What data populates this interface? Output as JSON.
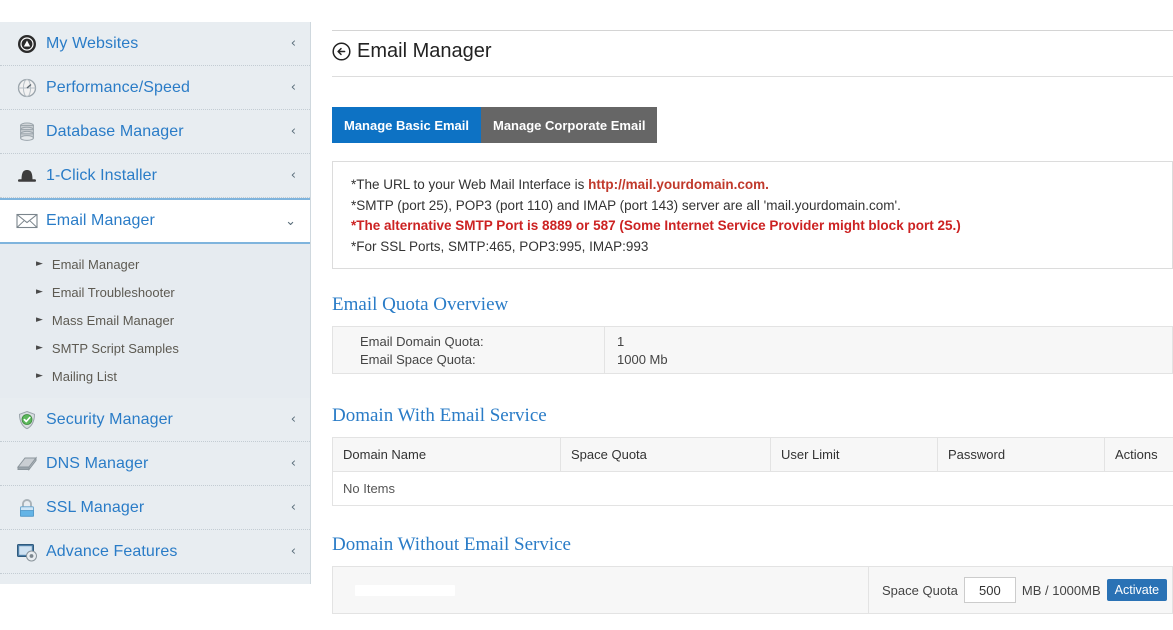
{
  "sidebar": {
    "items": [
      {
        "label": "My Websites",
        "icon": "globe-triangle-icon",
        "chevron": "‹",
        "active": false
      },
      {
        "label": "Performance/Speed",
        "icon": "speedometer-globe-icon",
        "chevron": "‹",
        "active": false
      },
      {
        "label": "Database Manager",
        "icon": "database-icon",
        "chevron": "‹",
        "active": false
      },
      {
        "label": "1-Click Installer",
        "icon": "hat-icon",
        "chevron": "‹",
        "active": false
      },
      {
        "label": "Email Manager",
        "icon": "envelope-icon",
        "chevron": "⌄",
        "active": true
      },
      {
        "label": "Security Manager",
        "icon": "shield-check-icon",
        "chevron": "‹",
        "active": false
      },
      {
        "label": "DNS Manager",
        "icon": "dns-icon",
        "chevron": "‹",
        "active": false
      },
      {
        "label": "SSL Manager",
        "icon": "lock-icon",
        "chevron": "‹",
        "active": false
      },
      {
        "label": "Advance Features",
        "icon": "advanced-gear-icon",
        "chevron": "‹",
        "active": false
      }
    ],
    "submenu": [
      {
        "label": "Email Manager"
      },
      {
        "label": "Email Troubleshooter"
      },
      {
        "label": "Mass Email Manager"
      },
      {
        "label": "SMTP Script Samples"
      },
      {
        "label": "Mailing List"
      }
    ]
  },
  "header": {
    "title": "Email Manager",
    "icon": "back-circle-arrow-icon"
  },
  "tabs": [
    {
      "label": "Manage Basic Email",
      "state": "active"
    },
    {
      "label": "Manage Corporate Email",
      "state": "inactive"
    }
  ],
  "notice": {
    "line1_pre": "*The URL to your Web Mail Interface is ",
    "line1_link": "http://mail.yourdomain.com.",
    "line2": "*SMTP (port 25), POP3 (port 110) and IMAP (port 143) server are all 'mail.yourdomain.com'.",
    "line3": "*The alternative SMTP Port is 8889 or 587 (Some Internet Service Provider might block port 25.)",
    "line4": "*For SSL Ports, SMTP:465, POP3:995, IMAP:993"
  },
  "quota": {
    "heading": "Email Quota Overview",
    "domain_quota_label": "Email Domain Quota:",
    "space_quota_label": "Email Space Quota:",
    "domain_quota_value": "1",
    "space_quota_value": "1000 Mb"
  },
  "with_service": {
    "heading": "Domain With Email Service",
    "columns": [
      "Domain Name",
      "Space Quota",
      "User Limit",
      "Password",
      "Actions"
    ],
    "empty_text": "No Items"
  },
  "without_service": {
    "heading": "Domain Without Email Service",
    "domain_name": "",
    "quota_label": "Space Quota",
    "quota_value": "500",
    "unit_text": "MB / 1000MB",
    "activate_label": "Activate"
  },
  "colors": {
    "accent_blue": "#2a7cc7",
    "tab_blue": "#0d72c4",
    "tab_gray": "#666666",
    "warn_red": "#cc2222",
    "sidebar_bg": "#e8edf1",
    "button_blue": "#2a72b5"
  }
}
